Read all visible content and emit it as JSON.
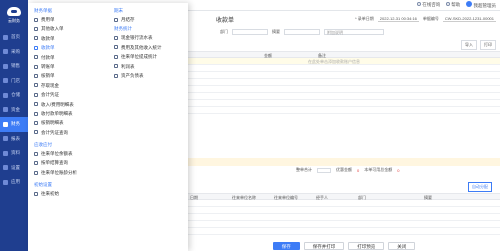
{
  "app": {
    "logo_caption": "云财务"
  },
  "sidebar": {
    "items": [
      {
        "label": "首页",
        "icon": "home-icon"
      },
      {
        "label": "采购",
        "icon": "cart-icon"
      },
      {
        "label": "销售",
        "icon": "sales-icon"
      },
      {
        "label": "门店",
        "icon": "store-icon"
      },
      {
        "label": "仓储",
        "icon": "warehouse-icon"
      },
      {
        "label": "资金",
        "icon": "fund-icon"
      },
      {
        "label": "财务",
        "icon": "finance-icon",
        "active": true
      },
      {
        "label": "报表",
        "icon": "report-icon"
      },
      {
        "label": "资料",
        "icon": "data-icon"
      },
      {
        "label": "设置",
        "icon": "settings-icon"
      },
      {
        "label": "应用",
        "icon": "apps-icon"
      }
    ]
  },
  "topbar": {
    "online_service": "在线咨询",
    "help": "帮助",
    "user": "我超管理员"
  },
  "menu": {
    "col1": {
      "sec1": "财务单据",
      "items1": [
        "费用单",
        "其他收入单",
        "收款单",
        "付款单",
        "付款单",
        "转账单",
        "核销单",
        "存取现金"
      ],
      "sec_extra": "会计凭证",
      "items_extra": [
        "收入/费用明细表",
        "收付款单明细表",
        "核销明细表",
        "会计凭证查询"
      ],
      "sec2": "应收应付",
      "items2": [
        "往来单位余额表",
        "按单结算查询",
        "往来单位账龄分析"
      ],
      "sec3": "初始设置",
      "items3": [
        "往来初始"
      ]
    },
    "col2": {
      "sec1": "期末",
      "items1": [
        "月结存"
      ],
      "sec2": "财务统计",
      "items2": [
        "现金银行流水表",
        "费用及其他收入统计",
        "往来单位提成统计",
        "利润表",
        "资产负债表"
      ]
    },
    "highlighted": "收款单"
  },
  "form": {
    "title": "收款单",
    "date_label": "* 录单日期",
    "date_value": "2022-12-31 00:34:16",
    "doc_no_label": "单据编号",
    "doc_no_value": "CW-SKD-2022-1231-00001",
    "dept_label": "部门",
    "summary_label": "摘要",
    "remark_placeholder": "附加说明",
    "toolbar_import": "导入",
    "toolbar_print": "打印",
    "grid_headers": [
      "金额",
      "备注"
    ],
    "grid_hint": "在此处单击添加收款账户信息",
    "amount_labels": [
      "整单合计",
      "优惠金额",
      "本单可用总金额"
    ],
    "amount_zero": "0",
    "subgrid_button": "自动分配",
    "subgrid_headers": [
      "日期",
      "往来单位名称",
      "往来单位编号",
      "经手人",
      "部门",
      "摘要"
    ],
    "buttons": [
      "保存",
      "保存并打印",
      "打印预览",
      "关闭"
    ]
  }
}
